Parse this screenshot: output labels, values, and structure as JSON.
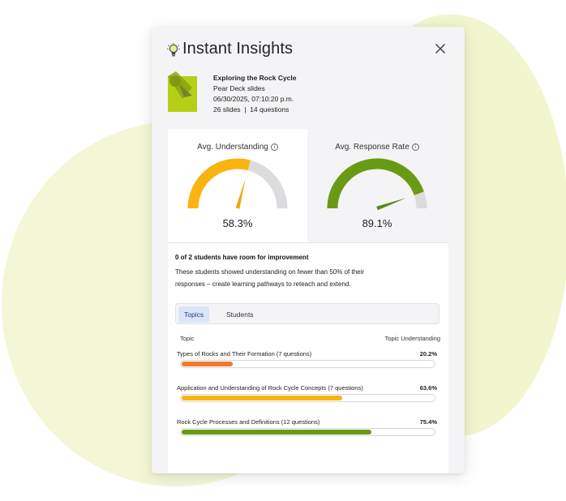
{
  "panel": {
    "title": "Instant Insights",
    "title_icon": "lightbulb-icon",
    "close_icon": "close-icon"
  },
  "lesson": {
    "title": "Exploring the Rock Cycle",
    "source": "Pear Deck slides",
    "datetime": "06/30/2025, 07:10:20 p.m.",
    "stats": "26 slides  |  14 questions"
  },
  "gauges": [
    {
      "label": "Avg. Understanding",
      "value_text": "58.3%",
      "value": 58.3,
      "color": "#fbb40f",
      "track": "#dcdcdf",
      "needle": "#f0a800"
    },
    {
      "label": "Avg. Response Rate",
      "value_text": "89.1%",
      "value": 89.1,
      "color": "#6a9a14",
      "track": "#dcdcdf",
      "needle": "#5d8a0e"
    }
  ],
  "summary": {
    "title": "0 of 2 students have room for improvement",
    "text": "These students showed understanding on fewer than 50% of their responses – create learning pathways to reteach and extend."
  },
  "tabs": [
    {
      "label": "Topics",
      "selected": true
    },
    {
      "label": "Students",
      "selected": false
    }
  ],
  "table": {
    "col_topic": "Topic",
    "col_understanding": "Topic Understanding",
    "rows": [
      {
        "name": "Types of Rocks and Their Formation (7 questions)",
        "pct_text": "20.2%",
        "pct": 20.2,
        "color": "#f07a2e"
      },
      {
        "name": "Application and Understanding of Rock Cycle Concepts (7 questions)",
        "pct_text": "63.6%",
        "pct": 63.6,
        "color": "#fbb40f"
      },
      {
        "name": "Rock Cycle Processes and Definitions (12 questions)",
        "pct_text": "75.4%",
        "pct": 75.4,
        "color": "#6a9a14"
      }
    ]
  },
  "colors": {
    "brand_green": "#b5cf16",
    "background_blob": "#f1f6cf"
  }
}
